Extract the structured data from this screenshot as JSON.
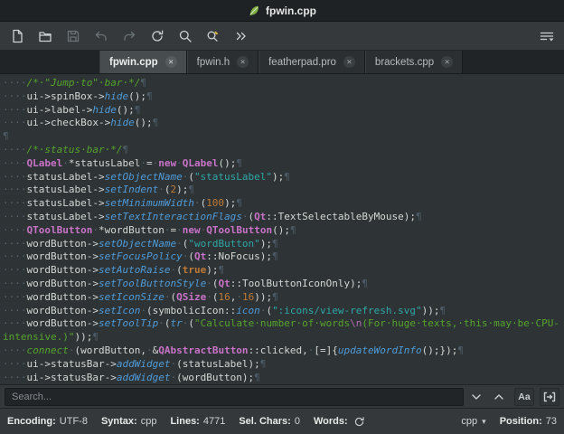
{
  "window": {
    "title": "fpwin.cpp"
  },
  "toolbar": {
    "buttons": [
      "new-document",
      "open-file",
      "save-file",
      "undo",
      "redo",
      "reload",
      "search",
      "search-and-replace",
      "more-buttons",
      "menu"
    ]
  },
  "tab_close_glyph": "✕",
  "tabs": [
    {
      "label": "fpwin.cpp",
      "active": true
    },
    {
      "label": "fpwin.h",
      "active": false
    },
    {
      "label": "featherpad.pro",
      "active": false
    },
    {
      "label": "brackets.cpp",
      "active": false
    }
  ],
  "editor": {
    "lines": [
      [
        [
          "ws",
          "····"
        ],
        [
          "cm",
          "/*·\"Jump·to\"·bar·*/"
        ],
        [
          "pi",
          "¶"
        ]
      ],
      [
        [
          "ws",
          "····"
        ],
        [
          "tx",
          "ui->spinBox->"
        ],
        [
          "fn",
          "hide"
        ],
        [
          "tx",
          "();"
        ],
        [
          "pi",
          "¶"
        ]
      ],
      [
        [
          "ws",
          "····"
        ],
        [
          "tx",
          "ui->label->"
        ],
        [
          "fn",
          "hide"
        ],
        [
          "tx",
          "();"
        ],
        [
          "pi",
          "¶"
        ]
      ],
      [
        [
          "ws",
          "····"
        ],
        [
          "tx",
          "ui->checkBox->"
        ],
        [
          "fn",
          "hide"
        ],
        [
          "tx",
          "();"
        ],
        [
          "pi",
          "¶"
        ]
      ],
      [
        [
          "pi",
          "¶"
        ]
      ],
      [
        [
          "ws",
          "····"
        ],
        [
          "cm",
          "/*·status·bar·*/"
        ],
        [
          "pi",
          "¶"
        ]
      ],
      [
        [
          "ws",
          "····"
        ],
        [
          "ty",
          "QLabel"
        ],
        [
          "ws",
          "·"
        ],
        [
          "tx",
          "*statusLabel"
        ],
        [
          "ws",
          "·"
        ],
        [
          "tx",
          "="
        ],
        [
          "ws",
          "·"
        ],
        [
          "kw",
          "new"
        ],
        [
          "ws",
          "·"
        ],
        [
          "ty",
          "QLabel"
        ],
        [
          "tx",
          "();"
        ],
        [
          "pi",
          "¶"
        ]
      ],
      [
        [
          "ws",
          "····"
        ],
        [
          "tx",
          "statusLabel->"
        ],
        [
          "fn",
          "setObjectName"
        ],
        [
          "ws",
          "·"
        ],
        [
          "tx",
          "("
        ],
        [
          "st",
          "\"statusLabel\""
        ],
        [
          "tx",
          ");"
        ],
        [
          "pi",
          "¶"
        ]
      ],
      [
        [
          "ws",
          "····"
        ],
        [
          "tx",
          "statusLabel->"
        ],
        [
          "fn",
          "setIndent"
        ],
        [
          "ws",
          "·"
        ],
        [
          "tx",
          "("
        ],
        [
          "nu",
          "2"
        ],
        [
          "tx",
          ");"
        ],
        [
          "pi",
          "¶"
        ]
      ],
      [
        [
          "ws",
          "····"
        ],
        [
          "tx",
          "statusLabel->"
        ],
        [
          "fn",
          "setMinimumWidth"
        ],
        [
          "ws",
          "·"
        ],
        [
          "tx",
          "("
        ],
        [
          "nu",
          "100"
        ],
        [
          "tx",
          ");"
        ],
        [
          "pi",
          "¶"
        ]
      ],
      [
        [
          "ws",
          "····"
        ],
        [
          "tx",
          "statusLabel->"
        ],
        [
          "fn",
          "setTextInteractionFlags"
        ],
        [
          "ws",
          "·"
        ],
        [
          "tx",
          "("
        ],
        [
          "ty",
          "Qt"
        ],
        [
          "tx",
          "::TextSelectableByMouse);"
        ],
        [
          "pi",
          "¶"
        ]
      ],
      [
        [
          "ws",
          "····"
        ],
        [
          "ty",
          "QToolButton"
        ],
        [
          "ws",
          "·"
        ],
        [
          "tx",
          "*wordButton"
        ],
        [
          "ws",
          "·"
        ],
        [
          "tx",
          "="
        ],
        [
          "ws",
          "·"
        ],
        [
          "kw",
          "new"
        ],
        [
          "ws",
          "·"
        ],
        [
          "ty",
          "QToolButton"
        ],
        [
          "tx",
          "();"
        ],
        [
          "pi",
          "¶"
        ]
      ],
      [
        [
          "ws",
          "····"
        ],
        [
          "tx",
          "wordButton->"
        ],
        [
          "fn",
          "setObjectName"
        ],
        [
          "ws",
          "·"
        ],
        [
          "tx",
          "("
        ],
        [
          "st",
          "\"wordButton\""
        ],
        [
          "tx",
          ");"
        ],
        [
          "pi",
          "¶"
        ]
      ],
      [
        [
          "ws",
          "····"
        ],
        [
          "tx",
          "wordButton->"
        ],
        [
          "fn",
          "setFocusPolicy"
        ],
        [
          "ws",
          "·"
        ],
        [
          "tx",
          "("
        ],
        [
          "ty",
          "Qt"
        ],
        [
          "tx",
          "::NoFocus);"
        ],
        [
          "pi",
          "¶"
        ]
      ],
      [
        [
          "ws",
          "····"
        ],
        [
          "tx",
          "wordButton->"
        ],
        [
          "fn",
          "setAutoRaise"
        ],
        [
          "ws",
          "·"
        ],
        [
          "tx",
          "("
        ],
        [
          "bo",
          "true"
        ],
        [
          "tx",
          ");"
        ],
        [
          "pi",
          "¶"
        ]
      ],
      [
        [
          "ws",
          "····"
        ],
        [
          "tx",
          "wordButton->"
        ],
        [
          "fn",
          "setToolButtonStyle"
        ],
        [
          "ws",
          "·"
        ],
        [
          "tx",
          "("
        ],
        [
          "ty",
          "Qt"
        ],
        [
          "tx",
          "::ToolButtonIconOnly);"
        ],
        [
          "pi",
          "¶"
        ]
      ],
      [
        [
          "ws",
          "····"
        ],
        [
          "tx",
          "wordButton->"
        ],
        [
          "fn",
          "setIconSize"
        ],
        [
          "ws",
          "·"
        ],
        [
          "tx",
          "("
        ],
        [
          "ty",
          "QSize"
        ],
        [
          "ws",
          "·"
        ],
        [
          "tx",
          "("
        ],
        [
          "nu",
          "16"
        ],
        [
          "tx",
          ","
        ],
        [
          "ws",
          "·"
        ],
        [
          "nu",
          "16"
        ],
        [
          "tx",
          "));"
        ],
        [
          "pi",
          "¶"
        ]
      ],
      [
        [
          "ws",
          "····"
        ],
        [
          "tx",
          "wordButton->"
        ],
        [
          "fn",
          "setIcon"
        ],
        [
          "ws",
          "·"
        ],
        [
          "tx",
          "(symbolicIcon::"
        ],
        [
          "fn",
          "icon"
        ],
        [
          "ws",
          "·"
        ],
        [
          "tx",
          "("
        ],
        [
          "st",
          "\":icons/view-refresh.svg\""
        ],
        [
          "tx",
          "));"
        ],
        [
          "pi",
          "¶"
        ]
      ],
      [
        [
          "ws",
          "····"
        ],
        [
          "tx",
          "wordButton->"
        ],
        [
          "fn",
          "setToolTip"
        ],
        [
          "ws",
          "·"
        ],
        [
          "tx",
          "("
        ],
        [
          "fn",
          "tr"
        ],
        [
          "ws",
          "·"
        ],
        [
          "tx",
          "("
        ],
        [
          "tr",
          "\"Calculate·number·of·words"
        ],
        [
          "esc",
          "\\n"
        ],
        [
          "tr",
          "(For·huge·texts,·this·may·be·CPU-"
        ]
      ],
      [
        [
          "tr",
          "intensive.)\""
        ],
        [
          "tx",
          "));"
        ],
        [
          "pi",
          "¶"
        ]
      ],
      [
        [
          "ws",
          "····"
        ],
        [
          "cn",
          "connect"
        ],
        [
          "ws",
          "·"
        ],
        [
          "tx",
          "(wordButton,"
        ],
        [
          "ws",
          "·"
        ],
        [
          "tx",
          "&"
        ],
        [
          "ty",
          "QAbstractButton"
        ],
        [
          "tx",
          "::clicked,"
        ],
        [
          "ws",
          "·"
        ],
        [
          "tx",
          "[=]{"
        ],
        [
          "fn",
          "updateWordInfo"
        ],
        [
          "tx",
          "();});"
        ],
        [
          "pi",
          "¶"
        ]
      ],
      [
        [
          "ws",
          "····"
        ],
        [
          "tx",
          "ui->statusBar->"
        ],
        [
          "fn",
          "addWidget"
        ],
        [
          "ws",
          "·"
        ],
        [
          "tx",
          "(statusLabel);"
        ],
        [
          "pi",
          "¶"
        ]
      ],
      [
        [
          "ws",
          "····"
        ],
        [
          "tx",
          "ui->statusBar->"
        ],
        [
          "fn",
          "addWidget"
        ],
        [
          "ws",
          "·"
        ],
        [
          "tx",
          "(wordButton);"
        ],
        [
          "pi",
          "¶"
        ]
      ]
    ]
  },
  "search": {
    "placeholder": "Search...",
    "match_case_icon": "Aa"
  },
  "statusbar": {
    "encoding_label": "Encoding:",
    "encoding": "UTF-8",
    "syntax_label": "Syntax:",
    "syntax": "cpp",
    "lines_label": "Lines:",
    "lines": "4771",
    "sel_label": "Sel. Chars:",
    "sel": "0",
    "words_label": "Words:",
    "syntax_select": "cpp",
    "caret_glyph": "▾",
    "position_label": "Position:",
    "position": "73"
  }
}
